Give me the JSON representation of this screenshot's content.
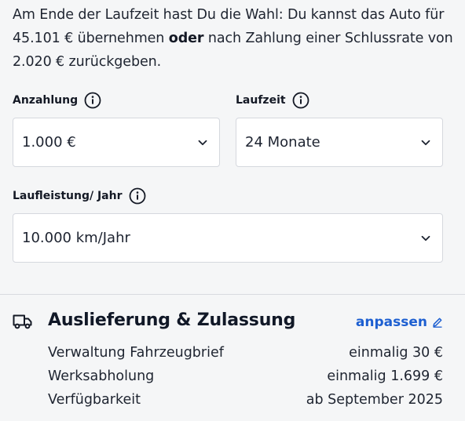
{
  "intro": {
    "part1": "Am Ende der Laufzeit hast Du die Wahl: Du kannst das Auto für 45.101 € übernehmen ",
    "bold": "oder",
    "part2": " nach Zahlung einer Schlussrate von 2.020 € zurückgeben."
  },
  "fields": {
    "anzahlung": {
      "label": "Anzahlung",
      "value": "1.000 €"
    },
    "laufzeit": {
      "label": "Laufzeit",
      "value": "24 Monate"
    },
    "laufleistung": {
      "label": "Laufleistung/ Jahr",
      "value": "10.000 km/Jahr"
    }
  },
  "delivery": {
    "icon": "truck-icon",
    "title": "Auslieferung & Zulassung",
    "adjust_label": "anpassen",
    "rows": [
      {
        "label": "Verwaltung Fahrzeugbrief",
        "value": "einmalig 30 €"
      },
      {
        "label": "Werksabholung",
        "value": "einmalig 1.699 €"
      },
      {
        "label": "Verfügbarkeit",
        "value": "ab September 2025"
      }
    ]
  },
  "colors": {
    "accent": "#1d5fd1",
    "background": "#f5f6f7",
    "text": "#1d2330"
  }
}
